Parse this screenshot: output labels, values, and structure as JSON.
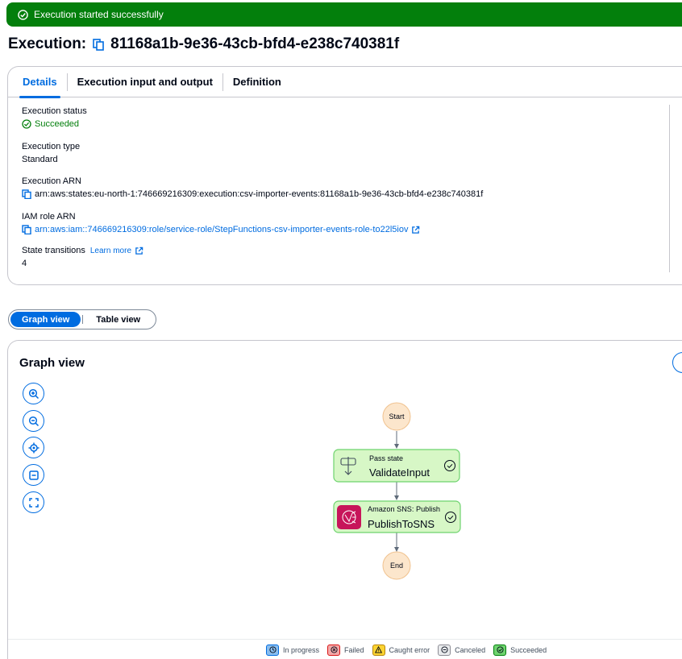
{
  "flash": {
    "message": "Execution started successfully"
  },
  "header": {
    "title_prefix": "Execution:",
    "execution_id": "81168a1b-9e36-43cb-bfd4-e238c740381f"
  },
  "tabs": [
    {
      "label": "Details",
      "active": true
    },
    {
      "label": "Execution input and output",
      "active": false
    },
    {
      "label": "Definition",
      "active": false
    }
  ],
  "details": {
    "status_label": "Execution status",
    "status_value": "Succeeded",
    "type_label": "Execution type",
    "type_value": "Standard",
    "arn_label": "Execution ARN",
    "arn_value": "arn:aws:states:eu-north-1:746669216309:execution:csv-importer-events:81168a1b-9e36-43cb-bfd4-e238c740381f",
    "role_label": "IAM role ARN",
    "role_value": "arn:aws:iam::746669216309:role/service-role/StepFunctions-csv-importer-events-role-to22l5iov",
    "transitions_label": "State transitions",
    "learn_more": "Learn more",
    "transitions_value": "4"
  },
  "view_toggle": {
    "graph": "Graph view",
    "table": "Table view",
    "selected": "graph"
  },
  "graph": {
    "title": "Graph view",
    "controls": [
      "zoom-in-icon",
      "zoom-out-icon",
      "center-icon",
      "fit-icon",
      "fullscreen-icon"
    ],
    "nodes": {
      "start": "Start",
      "validate_type": "Pass state",
      "validate_name": "ValidateInput",
      "publish_type": "Amazon SNS: Publish",
      "publish_name": "PublishToSNS",
      "end": "End"
    }
  },
  "legend": [
    {
      "label": "In progress",
      "color": "#89bdee"
    },
    {
      "label": "Failed",
      "color": "#f4a8a8"
    },
    {
      "label": "Caught error",
      "color": "#fbd332"
    },
    {
      "label": "Canceled",
      "color": "#e9ebed"
    },
    {
      "label": "Succeeded",
      "color": "#6ed36e"
    }
  ],
  "colors": {
    "accent": "#006ce0",
    "success": "#037f0c",
    "node_success_bg": "#d7f7c6",
    "node_success_border": "#6ed36e",
    "terminal_bg": "#fce6cc"
  }
}
